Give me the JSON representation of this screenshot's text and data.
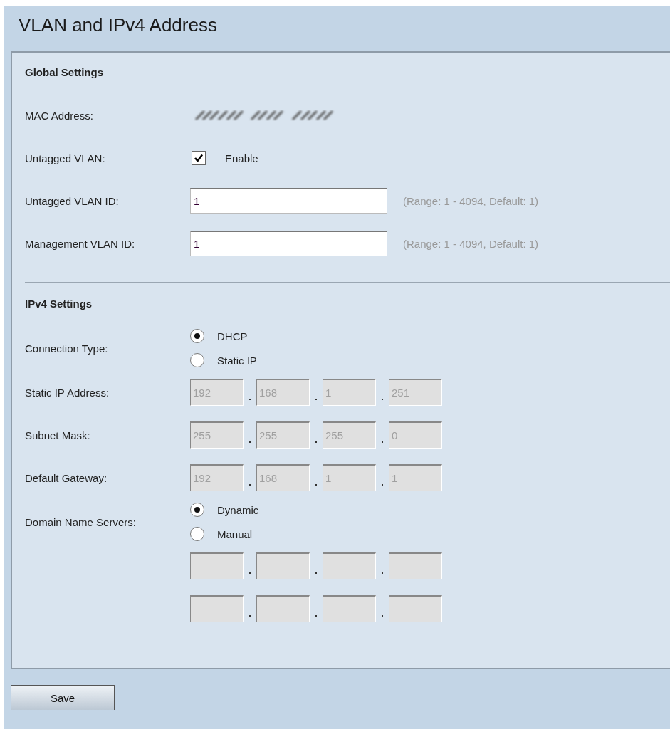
{
  "title": "VLAN and IPv4 Address",
  "sections": [
    {
      "heading": "Global Settings",
      "rows": [
        {
          "kind": "redacted",
          "label": "MAC Address:"
        },
        {
          "kind": "checkbox",
          "label": "Untagged VLAN:",
          "checked": true,
          "text": "Enable"
        },
        {
          "kind": "text",
          "label": "Untagged VLAN ID:",
          "value": "1",
          "hint": "(Range: 1 - 4094, Default: 1)"
        },
        {
          "kind": "text",
          "label": "Management VLAN ID:",
          "value": "1",
          "hint": "(Range: 1 - 4094, Default: 1)"
        }
      ]
    },
    {
      "heading": "IPv4 Settings",
      "rows": [
        {
          "kind": "radio",
          "label": "Connection Type:",
          "options": [
            {
              "label": "DHCP",
              "selected": true
            },
            {
              "label": "Static IP",
              "selected": false
            }
          ]
        },
        {
          "kind": "ip",
          "label": "Static IP Address:",
          "disabled": true,
          "octets": [
            "192",
            "168",
            "1",
            "251"
          ]
        },
        {
          "kind": "ip",
          "label": "Subnet Mask:",
          "disabled": true,
          "octets": [
            "255",
            "255",
            "255",
            "0"
          ]
        },
        {
          "kind": "ip",
          "label": "Default Gateway:",
          "disabled": true,
          "octets": [
            "192",
            "168",
            "1",
            "1"
          ]
        },
        {
          "kind": "radio",
          "label": "Domain Name Servers:",
          "options": [
            {
              "label": "Dynamic",
              "selected": true
            },
            {
              "label": "Manual",
              "selected": false
            }
          ]
        },
        {
          "kind": "ip",
          "disabled": true
        },
        {
          "kind": "ip",
          "disabled": true
        }
      ]
    }
  ],
  "save": "Save"
}
